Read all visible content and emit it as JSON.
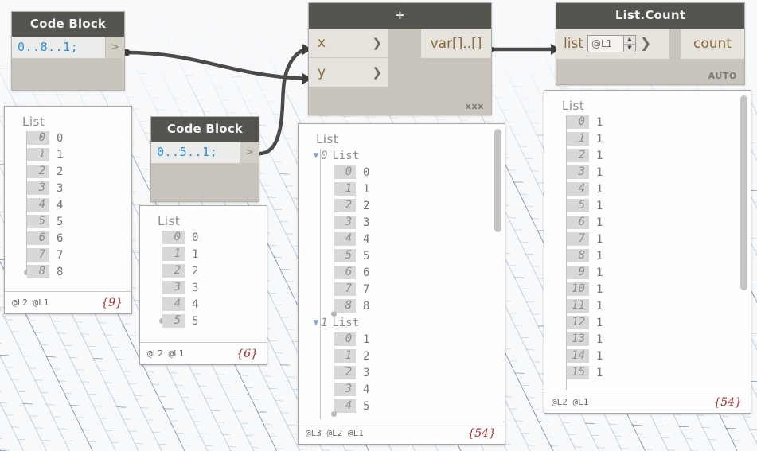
{
  "canvas": {
    "background_color": "#f7f9fb",
    "grid_color": "#96b2d2"
  },
  "nodes": {
    "code_block_1": {
      "title": "Code Block",
      "code": "0..8..1;",
      "output_port": ">"
    },
    "code_block_2": {
      "title": "Code Block",
      "code": "0..5..1;",
      "output_port": ">"
    },
    "plus": {
      "title": "+",
      "inputs": [
        {
          "label": "x",
          "chevron": "❯"
        },
        {
          "label": "y",
          "chevron": "❯"
        }
      ],
      "output": "var[]..[]",
      "lacing": "xxx"
    },
    "list_count": {
      "title": "List.Count",
      "input_label": "list",
      "lacing_value": "@L1",
      "spinner_up": "▲",
      "spinner_down": "▼",
      "chevron": "❯",
      "output": "count",
      "lacing": "AUTO"
    }
  },
  "previews": {
    "p1": {
      "root_label": "List",
      "items": [
        {
          "index": "0",
          "value": "0"
        },
        {
          "index": "1",
          "value": "1"
        },
        {
          "index": "2",
          "value": "2"
        },
        {
          "index": "3",
          "value": "3"
        },
        {
          "index": "4",
          "value": "4"
        },
        {
          "index": "5",
          "value": "5"
        },
        {
          "index": "6",
          "value": "6"
        },
        {
          "index": "7",
          "value": "7"
        },
        {
          "index": "8",
          "value": "8"
        }
      ],
      "levels": "@L2 @L1",
      "count": "{9}"
    },
    "p2": {
      "root_label": "List",
      "items": [
        {
          "index": "0",
          "value": "0"
        },
        {
          "index": "1",
          "value": "1"
        },
        {
          "index": "2",
          "value": "2"
        },
        {
          "index": "3",
          "value": "3"
        },
        {
          "index": "4",
          "value": "4"
        },
        {
          "index": "5",
          "value": "5"
        }
      ],
      "levels": "@L2 @L1",
      "count": "{6}"
    },
    "p3": {
      "root_label": "List",
      "sublists": [
        {
          "index": "0",
          "label": "List",
          "caret": "▼",
          "items": [
            {
              "index": "0",
              "value": "0"
            },
            {
              "index": "1",
              "value": "1"
            },
            {
              "index": "2",
              "value": "2"
            },
            {
              "index": "3",
              "value": "3"
            },
            {
              "index": "4",
              "value": "4"
            },
            {
              "index": "5",
              "value": "5"
            },
            {
              "index": "6",
              "value": "6"
            },
            {
              "index": "7",
              "value": "7"
            },
            {
              "index": "8",
              "value": "8"
            }
          ]
        },
        {
          "index": "1",
          "label": "List",
          "caret": "▼",
          "items": [
            {
              "index": "0",
              "value": "1"
            },
            {
              "index": "1",
              "value": "2"
            },
            {
              "index": "2",
              "value": "3"
            },
            {
              "index": "3",
              "value": "4"
            },
            {
              "index": "4",
              "value": "5"
            }
          ]
        }
      ],
      "levels": "@L3 @L2 @L1",
      "count": "{54}"
    },
    "p4": {
      "root_label": "List",
      "items": [
        {
          "index": "0",
          "value": "1"
        },
        {
          "index": "1",
          "value": "1"
        },
        {
          "index": "2",
          "value": "1"
        },
        {
          "index": "3",
          "value": "1"
        },
        {
          "index": "4",
          "value": "1"
        },
        {
          "index": "5",
          "value": "1"
        },
        {
          "index": "6",
          "value": "1"
        },
        {
          "index": "7",
          "value": "1"
        },
        {
          "index": "8",
          "value": "1"
        },
        {
          "index": "9",
          "value": "1"
        },
        {
          "index": "10",
          "value": "1"
        },
        {
          "index": "11",
          "value": "1"
        },
        {
          "index": "12",
          "value": "1"
        },
        {
          "index": "13",
          "value": "1"
        },
        {
          "index": "14",
          "value": "1"
        },
        {
          "index": "15",
          "value": "1"
        }
      ],
      "levels": "@L2 @L1",
      "count": "{54}"
    }
  }
}
